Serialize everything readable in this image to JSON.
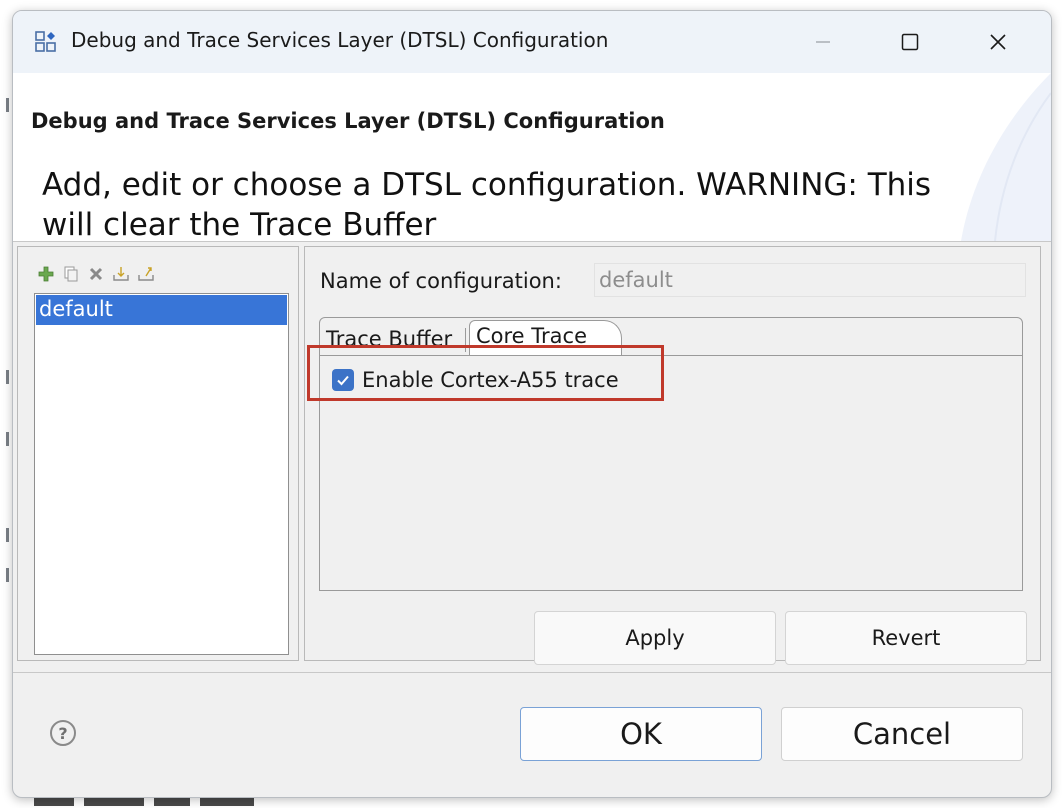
{
  "window": {
    "title": "Debug and Trace Services Layer (DTSL) Configuration",
    "controls": [
      "minimize-icon",
      "maximize-icon",
      "close-icon"
    ]
  },
  "banner": {
    "title": "Debug and Trace Services Layer (DTSL) Configuration",
    "message": "Add, edit or choose a DTSL configuration.  WARNING: This will clear the Trace Buffer"
  },
  "config_toolbar": {
    "icons": [
      "add-icon",
      "copy-icon",
      "delete-icon",
      "import-icon",
      "export-icon"
    ]
  },
  "config_list": {
    "items": [
      "default"
    ],
    "selected": "default"
  },
  "config_name": {
    "label": "Name of configuration:",
    "value": "default"
  },
  "tabs": [
    {
      "label": "Trace Buffer",
      "active": false
    },
    {
      "label": "Core Trace",
      "active": true
    }
  ],
  "core_trace": {
    "enable_label": "Enable Cortex-A55 trace",
    "enabled": true
  },
  "panel_buttons": {
    "apply": "Apply",
    "revert": "Revert"
  },
  "dialog_buttons": {
    "ok": "OK",
    "cancel": "Cancel"
  },
  "help_symbol": "?",
  "colors": {
    "selection": "#3875d7",
    "checkbox": "#3c73c7",
    "highlight_box": "#c0392b",
    "titlebar": "#eef3f9"
  }
}
